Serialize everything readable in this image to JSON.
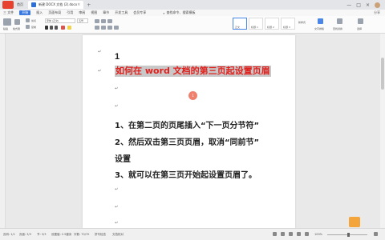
{
  "titlebar": {
    "home_tab": "首页",
    "document_tab": "新建 DOCX 文档 (2).docx",
    "close": "×",
    "new_tab": "+",
    "window_controls": [
      "—",
      "□",
      "×"
    ]
  },
  "menubar": {
    "items": [
      "三 文件",
      "开始",
      "插入",
      "页面布局",
      "引用",
      "审阅",
      "视图",
      "章节",
      "开发工具",
      "会员专享"
    ],
    "active": "开始",
    "search": "查找命令、搜索模板",
    "right": "分享"
  },
  "ribbon": {
    "labels": [
      "粘贴",
      "格式刷",
      "剪切",
      "复制",
      "宋体 (正文)",
      "五号",
      "正文",
      "标题 1",
      "标题 2",
      "标题 3",
      "新样式",
      "文字排版",
      "查找替换",
      "选择"
    ]
  },
  "document": {
    "paragraph_mark": "↵",
    "line1": "1",
    "title": "如何在 word 文档的第三页起设置页眉",
    "step1": "1、在第二页的页尾插入“下一页分节符”",
    "step2": "2、然后双击第三页页眉，取消“同前节”",
    "step2_cont": "设置",
    "step3": "3、就可以在第三页开始起设置页眉了。",
    "cursor_badge": "1"
  },
  "statusbar": {
    "page": "页码: 1/1",
    "section": "页面: 3/3",
    "section_label": "节: 3/3",
    "position": "设置值: 2.5厘米",
    "words": "字数: 70/70",
    "spell": "拼写检查",
    "doc_check": "文档校对",
    "zoom": "100%"
  },
  "colors": {
    "accent": "#3a78e0",
    "title_red": "#e0201d",
    "highlight": "#c8c8c8"
  }
}
